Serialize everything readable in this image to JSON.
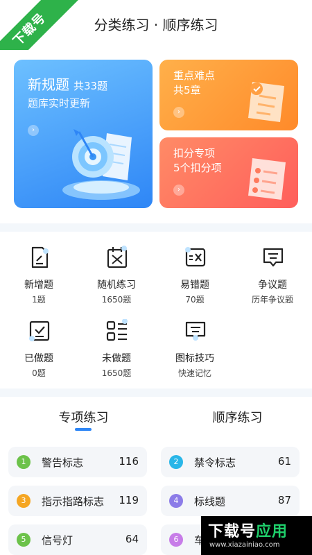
{
  "header": {
    "title": "分类练习 · 顺序练习",
    "corner_badge": "下载号"
  },
  "cards": {
    "new": {
      "title": "新规题",
      "count": "共33题",
      "subtitle": "题库实时更新"
    },
    "key": {
      "title": "重点难点",
      "subtitle": "共5章"
    },
    "deduct": {
      "title": "扣分专项",
      "subtitle": "5个扣分项"
    },
    "colors": {
      "blue": "#2e86f6",
      "orange": "#ff8a2a",
      "red": "#ff5e5b"
    }
  },
  "grid": [
    {
      "label": "新增题",
      "sub": "1题",
      "icon": "document-edit-icon"
    },
    {
      "label": "随机练习",
      "sub": "1650题",
      "icon": "shuffle-calendar-icon"
    },
    {
      "label": "易错题",
      "sub": "70题",
      "icon": "error-box-icon"
    },
    {
      "label": "争议题",
      "sub": "历年争议题",
      "icon": "comment-box-icon"
    },
    {
      "label": "已做题",
      "sub": "0题",
      "icon": "checked-box-icon"
    },
    {
      "label": "未做题",
      "sub": "1650题",
      "icon": "grid-list-icon"
    },
    {
      "label": "图标技巧",
      "sub": "快速记忆",
      "icon": "sign-icon"
    }
  ],
  "tabs": {
    "special": "专项练习",
    "sequence": "顺序练习",
    "active": "special"
  },
  "items": [
    {
      "num": "1",
      "name": "警告标志",
      "count": "116",
      "color": "#6cc24a"
    },
    {
      "num": "2",
      "name": "禁令标志",
      "count": "61",
      "color": "#29b6e8"
    },
    {
      "num": "3",
      "name": "指示指路标志",
      "count": "119",
      "color": "#f5a623"
    },
    {
      "num": "4",
      "name": "标线题",
      "count": "87",
      "color": "#8c7ce8"
    },
    {
      "num": "5",
      "name": "信号灯",
      "count": "64",
      "color": "#6cc24a"
    },
    {
      "num": "6",
      "name": "车",
      "count": "",
      "color": "#c77ce8"
    }
  ],
  "watermark": {
    "brand": "下载号",
    "brand_suffix": "应用",
    "url": "www.xiazainiao.com"
  }
}
